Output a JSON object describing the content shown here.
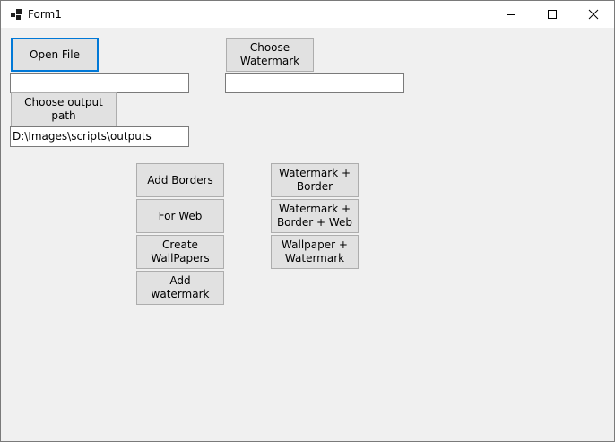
{
  "window": {
    "title": "Form1",
    "icon": "winforms-app-icon",
    "controls": {
      "minimize": "minimize-icon",
      "maximize": "maximize-icon",
      "close": "close-icon"
    }
  },
  "form": {
    "open_file_label": "Open File",
    "input_file_path": "",
    "choose_watermark_label": "Choose\nWatermark",
    "watermark_path": "",
    "choose_output_label": "Choose output\npath",
    "output_path": "D:\\Images\\scripts\\outputs",
    "actions_left": [
      "Add Borders",
      "For Web",
      "Create\nWallPapers",
      "Add watermark"
    ],
    "actions_right": [
      "Watermark +\nBorder",
      "Watermark +\nBorder + Web",
      "Wallpaper +\nWatermark"
    ]
  },
  "colors": {
    "focus_border": "#0078d7",
    "button_face": "#e1e1e1",
    "form_background": "#f0f0f0"
  }
}
